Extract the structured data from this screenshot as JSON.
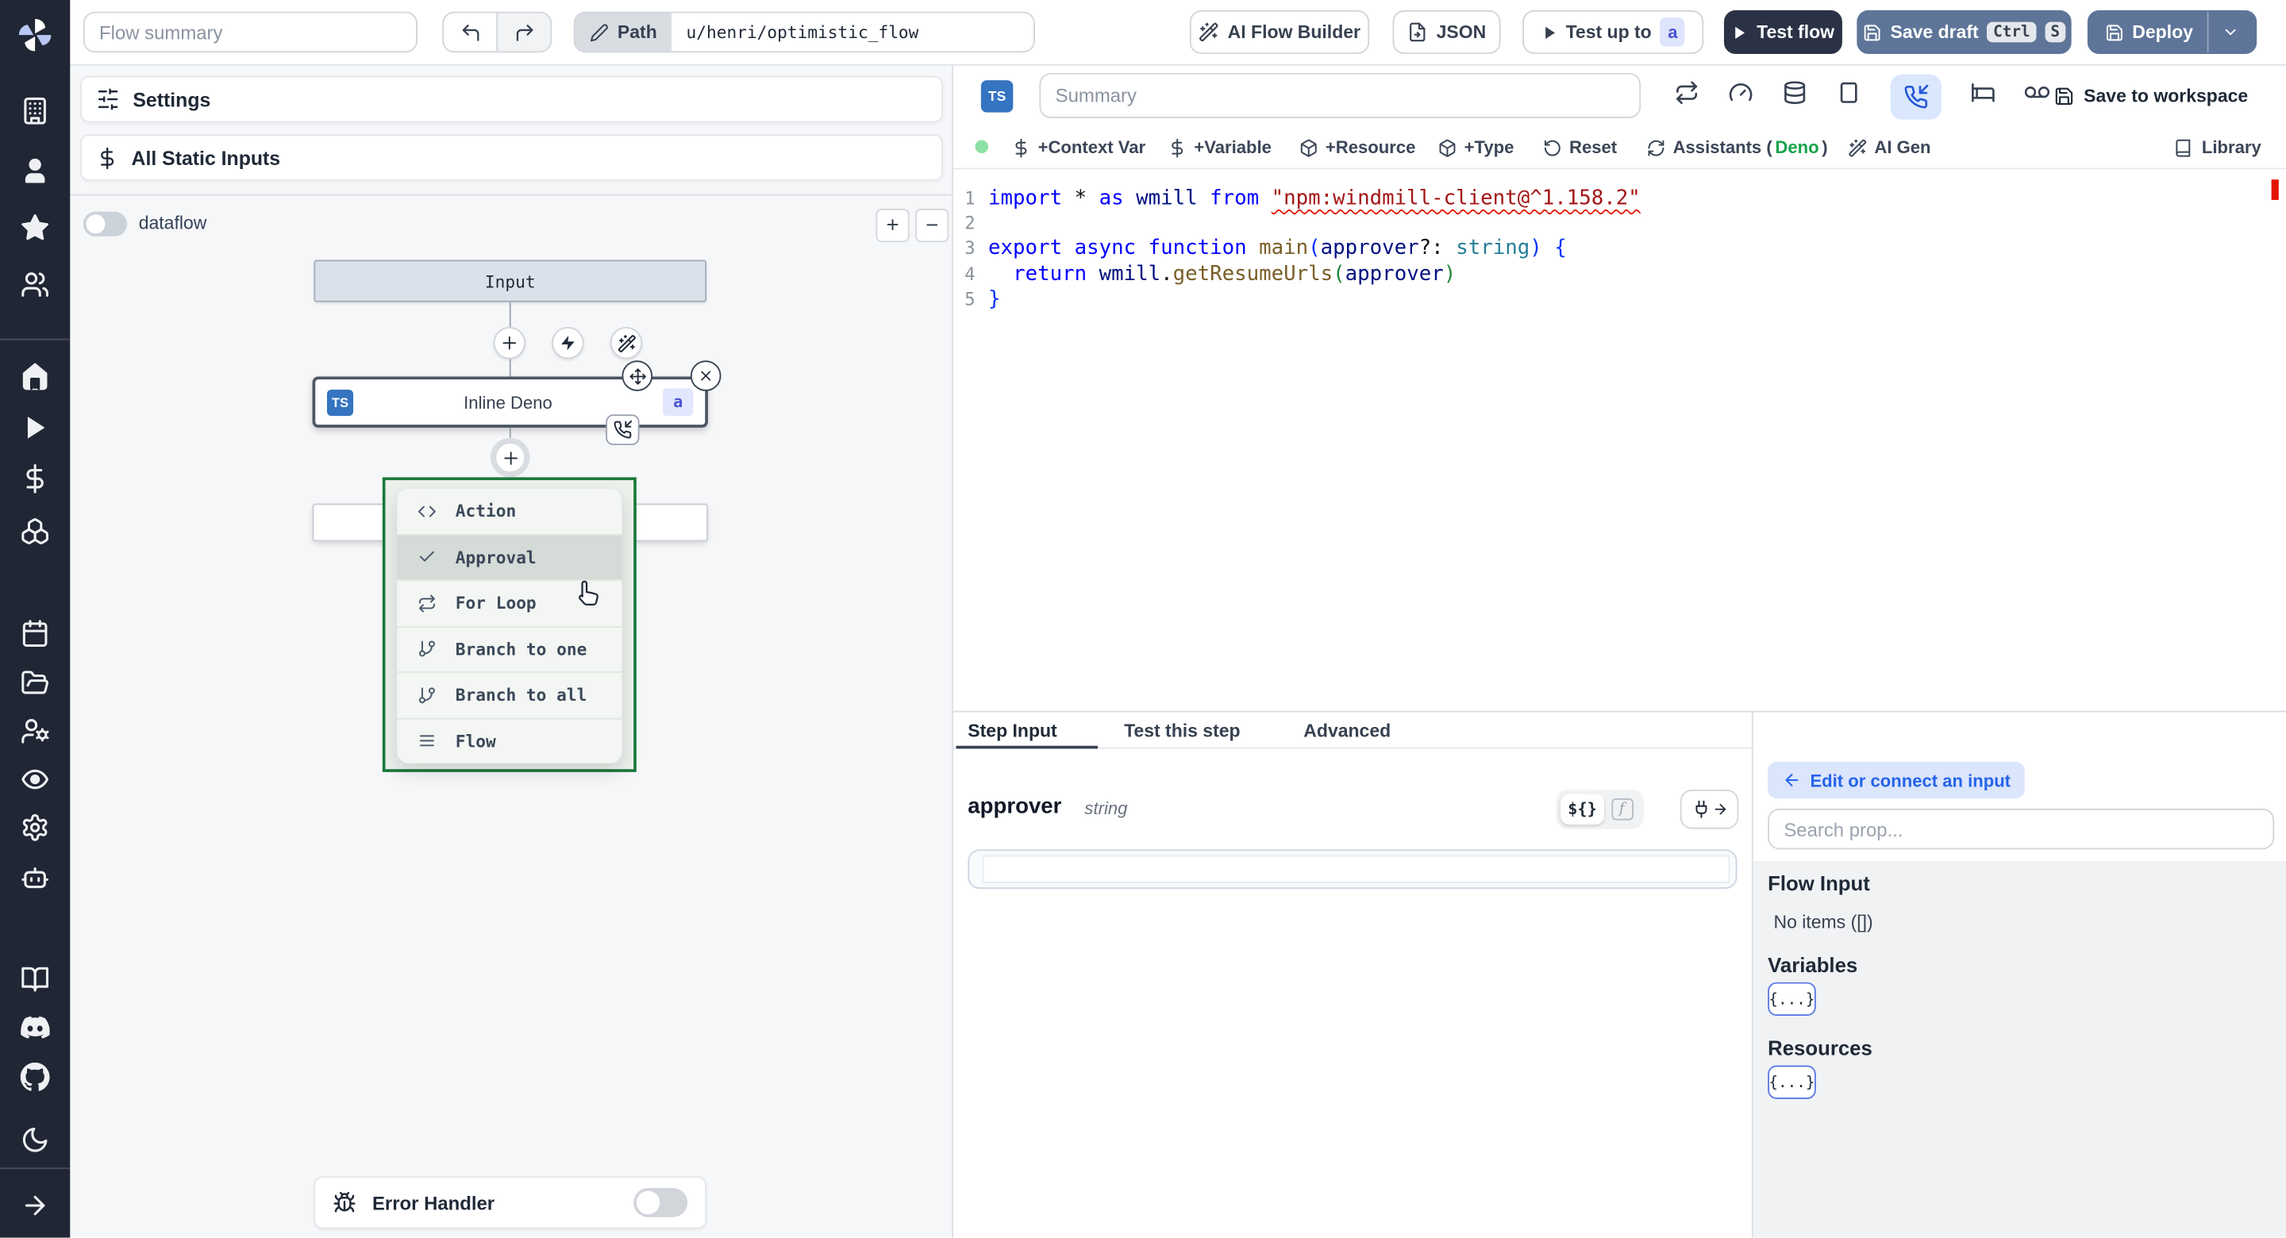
{
  "topbar": {
    "flow_summary_placeholder": "Flow summary",
    "path_label": "Path",
    "path_value": "u/henri/optimistic_flow",
    "ai_flow_builder": "AI Flow Builder",
    "json_button": "JSON",
    "test_up_to": "Test up to",
    "test_up_to_badge": "a",
    "test_flow": "Test flow",
    "save_draft": "Save draft",
    "save_draft_kbd": [
      "Ctrl",
      "S"
    ],
    "deploy": "Deploy"
  },
  "sidebar": {
    "icons": [
      "building-icon",
      "user-icon",
      "star-icon",
      "users-icon",
      "home-icon",
      "play-icon",
      "dollar-icon",
      "boxes-icon",
      "calendar-icon",
      "folder-open-icon",
      "user-cog-icon",
      "eye-icon",
      "settings-icon",
      "bot-icon",
      "book-open-icon",
      "discord-icon",
      "github-icon",
      "moon-icon",
      "arrow-right-icon"
    ]
  },
  "flow_panel": {
    "settings": "Settings",
    "all_static_inputs": "All Static Inputs",
    "dataflow": "dataflow",
    "dataflow_enabled": false,
    "zoom_in": "+",
    "zoom_out": "−",
    "input_node": "Input",
    "deno_node": {
      "lang_badge": "TS",
      "label": "Inline Deno",
      "badge": "a"
    },
    "insert_menu": {
      "items": [
        {
          "icon": "code-icon",
          "label": "Action",
          "highlighted": false
        },
        {
          "icon": "check-icon",
          "label": "Approval",
          "highlighted": true
        },
        {
          "icon": "repeat-icon",
          "label": "For Loop",
          "highlighted": false
        },
        {
          "icon": "git-branch-icon",
          "label": "Branch to one",
          "highlighted": false
        },
        {
          "icon": "git-branch-icon",
          "label": "Branch to all",
          "highlighted": false
        },
        {
          "icon": "menu-icon",
          "label": "Flow",
          "highlighted": false
        }
      ]
    },
    "error_handler": "Error Handler",
    "error_handler_enabled": false
  },
  "editor": {
    "lang_badge": "TS",
    "summary_placeholder": "Summary",
    "toolbar_icons": [
      "repeat-icon",
      "gauge-icon",
      "database-icon",
      "square-icon",
      "phone-incoming-icon",
      "bed-icon",
      "voicemail-icon"
    ],
    "active_toolbar_icon": "phone-incoming-icon",
    "save_to_workspace": "Save to workspace",
    "actions": [
      {
        "icon": "dollar-icon",
        "label": "+Context Var"
      },
      {
        "icon": "dollar-icon",
        "label": "+Variable"
      },
      {
        "icon": "package-icon",
        "label": "+Resource"
      },
      {
        "icon": "package-icon",
        "label": "+Type"
      },
      {
        "icon": "rotate-ccw-icon",
        "label": "Reset"
      },
      {
        "icon": "refresh-icon",
        "label": "Assistants (",
        "deno": "Deno",
        "close": ")"
      },
      {
        "icon": "wand-icon",
        "label": "AI Gen"
      }
    ],
    "library": "Library",
    "code": {
      "lines": [
        {
          "n": "1",
          "tokens": [
            {
              "t": "import ",
              "c": "kw"
            },
            {
              "t": "* ",
              "c": "pl"
            },
            {
              "t": "as ",
              "c": "kw"
            },
            {
              "t": "wmill ",
              "c": "vr"
            },
            {
              "t": "from ",
              "c": "kw"
            },
            {
              "t": "\"npm:windmill-client@^1.158.2\"",
              "c": "st sq"
            }
          ]
        },
        {
          "n": "2",
          "tokens": []
        },
        {
          "n": "3",
          "tokens": [
            {
              "t": "export ",
              "c": "kw"
            },
            {
              "t": "async ",
              "c": "kw"
            },
            {
              "t": "function ",
              "c": "kw"
            },
            {
              "t": "main",
              "c": "fn"
            },
            {
              "t": "(",
              "c": "bb"
            },
            {
              "t": "approver",
              "c": "vr"
            },
            {
              "t": "?: ",
              "c": "pl"
            },
            {
              "t": "string",
              "c": "ty"
            },
            {
              "t": ") ",
              "c": "bb"
            },
            {
              "t": "{",
              "c": "bb"
            }
          ]
        },
        {
          "n": "4",
          "tokens": [
            {
              "t": "  ",
              "c": "pl"
            },
            {
              "t": "return ",
              "c": "kw"
            },
            {
              "t": "wmill",
              "c": "vr"
            },
            {
              "t": ".",
              "c": "pl"
            },
            {
              "t": "getResumeUrls",
              "c": "fn"
            },
            {
              "t": "(",
              "c": "gr"
            },
            {
              "t": "approver",
              "c": "vr"
            },
            {
              "t": ")",
              "c": "gr"
            }
          ]
        },
        {
          "n": "5",
          "tokens": [
            {
              "t": "}",
              "c": "bb"
            }
          ]
        }
      ]
    }
  },
  "step_panel": {
    "tabs": [
      "Step Input",
      "Test this step",
      "Advanced"
    ],
    "active_tab": "Step Input",
    "field_name": "approver",
    "field_type": "string",
    "field_value": "",
    "expr_toggle": "${}",
    "fn_toggle": "f"
  },
  "connect_panel": {
    "edit_or_connect": "Edit or connect an input",
    "search_placeholder": "Search prop...",
    "sections": [
      {
        "title": "Flow Input",
        "empty": "No items ([])"
      },
      {
        "title": "Variables",
        "chip": "{...}"
      },
      {
        "title": "Resources",
        "chip": "{...}"
      }
    ]
  },
  "colors": {
    "slate_button": "#5e7599",
    "dark_button": "#2b3245",
    "ts_badge": "#3474c0",
    "indigo_badge_bg": "#dfe4fd",
    "indigo_badge_text": "#4a54cf",
    "active_chip_bg": "#dbe7fd",
    "menu_green_border": "#1c7a3d",
    "link_blue": "#2563eb",
    "green_dot": "#8ce2a4",
    "error_red": "#e51400"
  }
}
